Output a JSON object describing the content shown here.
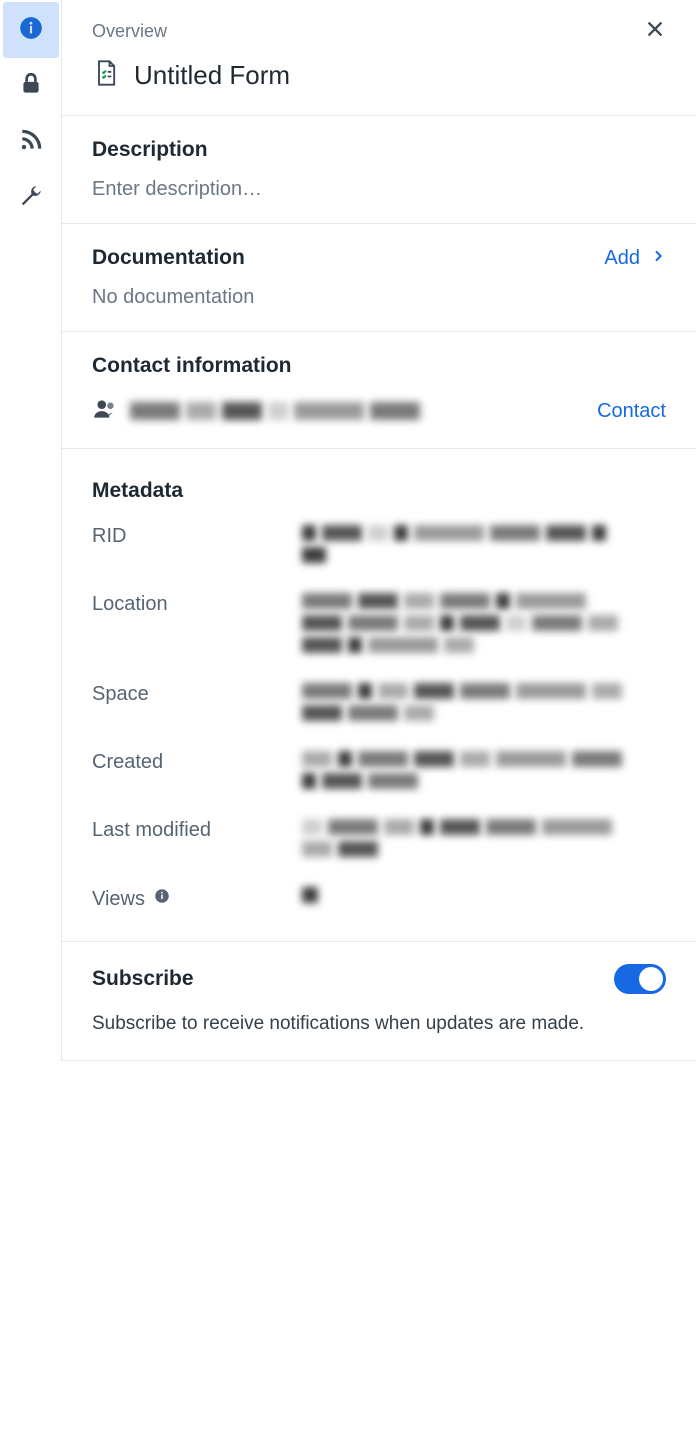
{
  "rail": {
    "items": [
      "info",
      "lock",
      "rss",
      "wrench"
    ],
    "active": 0
  },
  "header": {
    "overview_label": "Overview",
    "title": "Untitled Form"
  },
  "description": {
    "heading": "Description",
    "placeholder": "Enter description…"
  },
  "documentation": {
    "heading": "Documentation",
    "add_label": "Add",
    "empty_text": "No documentation"
  },
  "contact": {
    "heading": "Contact information",
    "action_label": "Contact"
  },
  "metadata": {
    "heading": "Metadata",
    "fields": {
      "rid": "RID",
      "location": "Location",
      "space": "Space",
      "created": "Created",
      "last_modified": "Last modified",
      "views": "Views"
    }
  },
  "subscribe": {
    "heading": "Subscribe",
    "enabled": true,
    "description": "Subscribe to receive notifications when updates are made."
  }
}
